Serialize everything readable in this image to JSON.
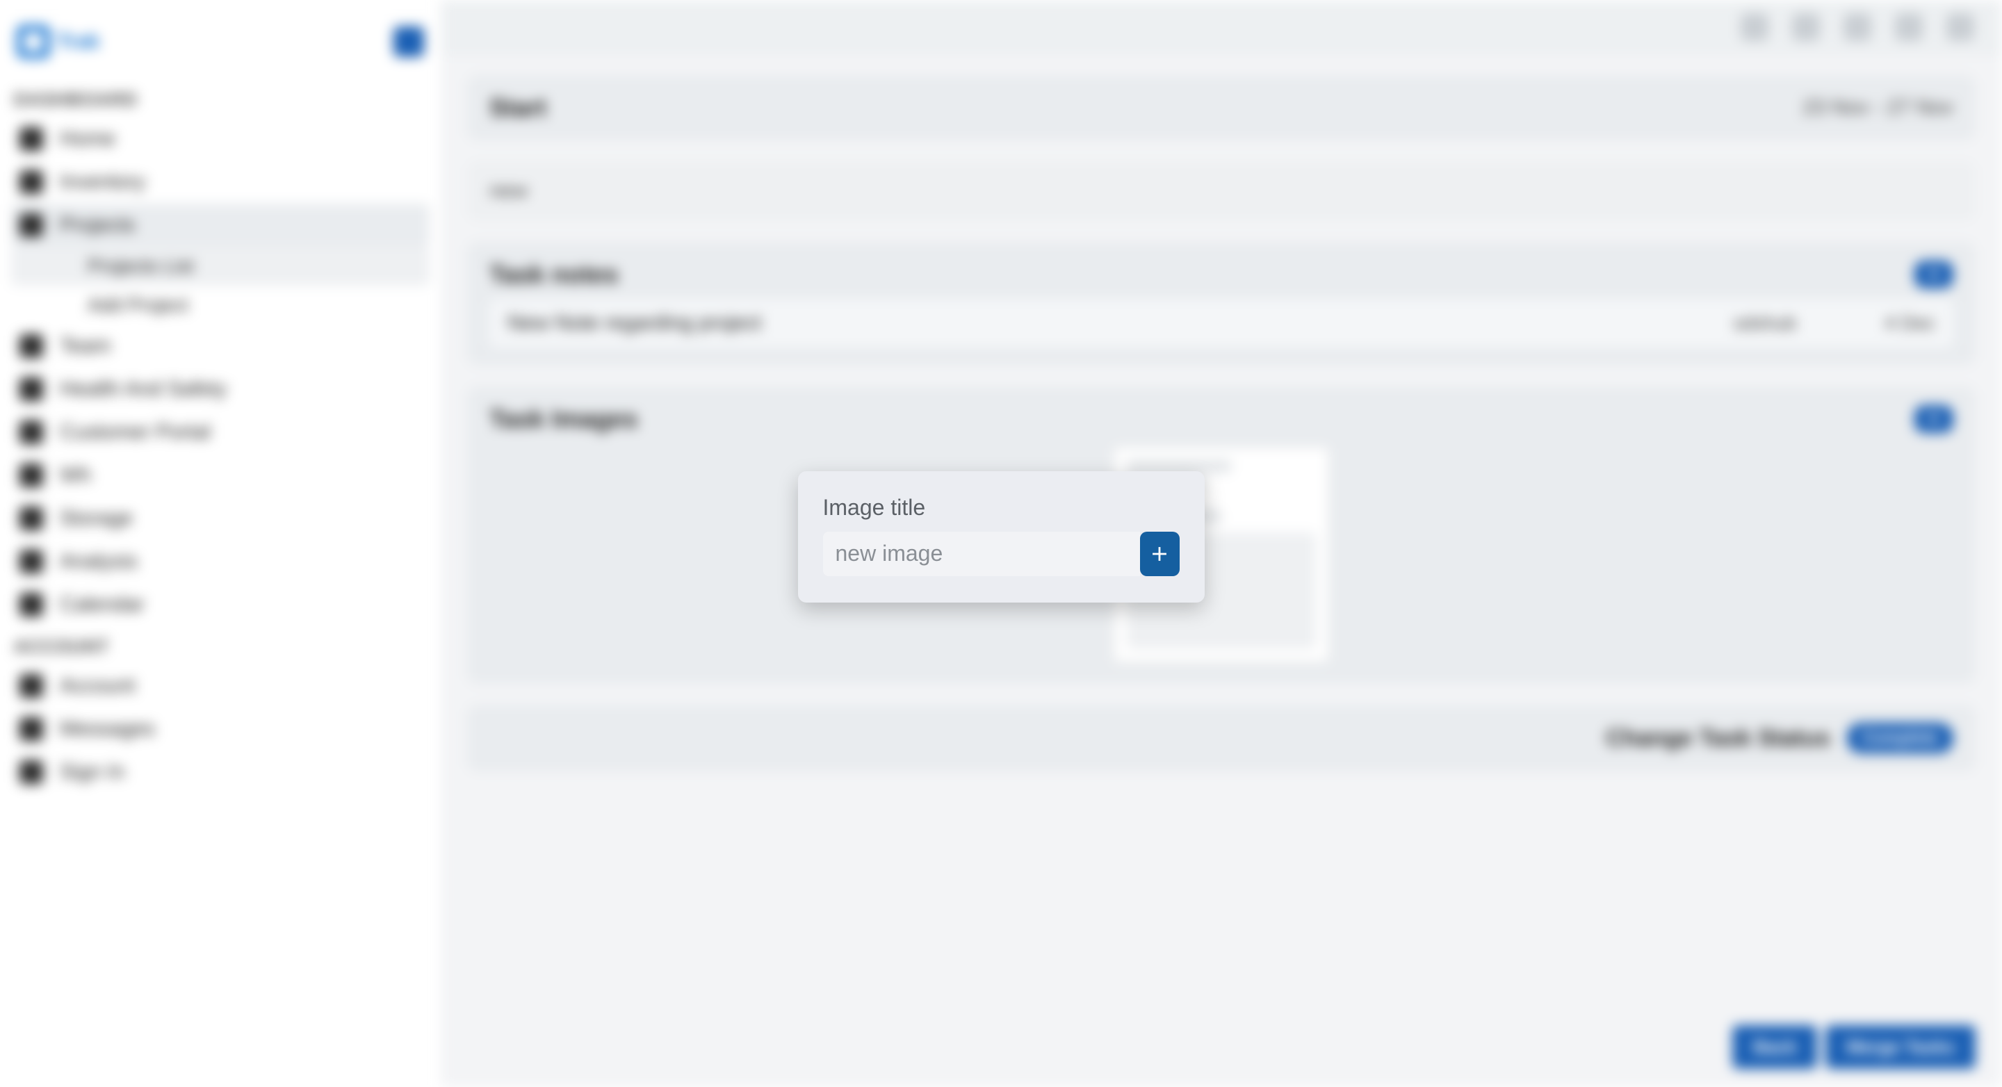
{
  "brand": {
    "name": "Trak"
  },
  "sidebar": {
    "sections": {
      "dashboard": "DASHBOARD",
      "account": "ACCOUNT"
    },
    "items": [
      {
        "label": "Home"
      },
      {
        "label": "Inventory"
      },
      {
        "label": "Projects"
      },
      {
        "label": "Team"
      },
      {
        "label": "Health And Safety"
      },
      {
        "label": "Customer Portal"
      },
      {
        "label": "Wh"
      },
      {
        "label": "Storage"
      },
      {
        "label": "Analysis"
      },
      {
        "label": "Calendar"
      }
    ],
    "project_subs": [
      {
        "label": "Projects List"
      },
      {
        "label": "Add Project"
      }
    ],
    "account_items": [
      {
        "label": "Account"
      },
      {
        "label": "Messages"
      },
      {
        "label": "Sign In"
      }
    ]
  },
  "header": {
    "title": "Start",
    "date_range": "23 Nov - 27 Nov",
    "status_word": "new"
  },
  "notes": {
    "title": "Task notes",
    "add": "+",
    "rows": [
      {
        "text": "New Note regarding project",
        "author": "sdshub",
        "date": "4 Dec"
      }
    ]
  },
  "images": {
    "title": "Task Images",
    "add_icon": "+"
  },
  "status_change": {
    "label": "Change Task Status",
    "button": "Complete"
  },
  "footer": {
    "back": "Back",
    "merge": "Merge Tasks"
  },
  "modal": {
    "label": "Image title",
    "placeholder": "new image"
  }
}
